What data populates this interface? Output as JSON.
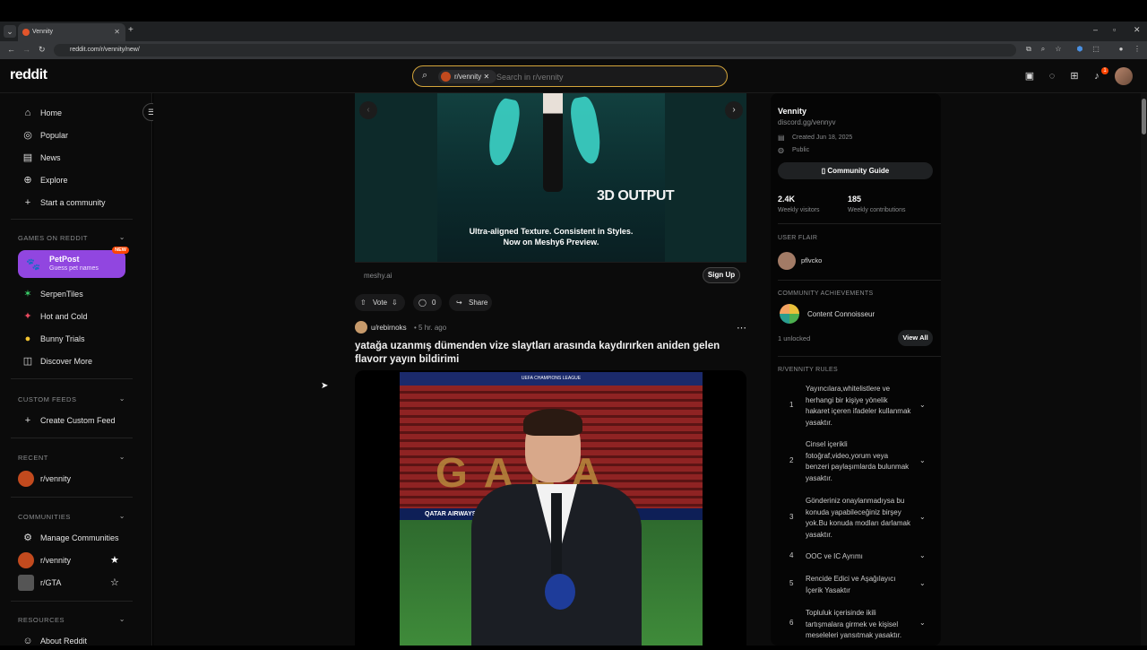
{
  "browser": {
    "tab_title": "Vennity",
    "url": "reddit.com/r/vennity/new/",
    "new_tab_symbol": "+"
  },
  "header": {
    "logo": "reddit",
    "search_chip": "r/vennity",
    "search_placeholder": "Search in r/vennity",
    "notification_count": "1"
  },
  "sidebar": {
    "nav": [
      {
        "label": "Home",
        "icon": "home-icon"
      },
      {
        "label": "Popular",
        "icon": "popular-icon"
      },
      {
        "label": "News",
        "icon": "news-icon"
      },
      {
        "label": "Explore",
        "icon": "explore-icon"
      },
      {
        "label": "Start a community",
        "icon": "plus-icon"
      }
    ],
    "games_heading": "GAMES ON REDDIT",
    "petpost": {
      "title": "PetPost",
      "subtitle": "Guess pet names",
      "badge": "NEW"
    },
    "games": [
      "SerpenTiles",
      "Hot and Cold",
      "Bunny Trials",
      "Discover More"
    ],
    "custom_feeds_heading": "CUSTOM FEEDS",
    "create_custom_feed": "Create Custom Feed",
    "recent_heading": "RECENT",
    "recent": [
      "r/vennity"
    ],
    "communities_heading": "COMMUNITIES",
    "manage_communities": "Manage Communities",
    "communities": [
      "r/vennity",
      "r/GTA"
    ],
    "resources_heading": "RESOURCES",
    "about": "About Reddit"
  },
  "ad": {
    "overlay_title": "3D OUTPUT",
    "caption_line1": "Ultra-aligned Texture. Consistent in Styles.",
    "caption_line2": "Now on Meshy6 Preview.",
    "domain": "meshy.ai",
    "cta": "Sign Up"
  },
  "actions": {
    "vote": "Vote",
    "comments": "0",
    "share": "Share"
  },
  "post": {
    "user": "u/rebirnoks",
    "time": "• 5 hr. ago",
    "title": "yatağa uzanmış dümenden vize slaytları arasında kaydırırken aniden gelen flavorr yayın bildirimi",
    "banner_text": "UEFA CHAMPIONS LEAGUE",
    "board_text": "QATAR AIRWAYS",
    "stadium_letters": "GALA"
  },
  "community": {
    "name": "Vennity",
    "link": "discord.gg/vennyv",
    "created": "Created Jun 18, 2025",
    "visibility": "Public",
    "guide_button": "Community Guide",
    "visitors_value": "2.4K",
    "visitors_label": "Weekly visitors",
    "contrib_value": "185",
    "contrib_label": "Weekly contributions",
    "flair_heading": "USER FLAIR",
    "flair_user": "pflvcko",
    "achievements_heading": "COMMUNITY ACHIEVEMENTS",
    "achievement": "Content Connoisseur",
    "unlocked": "1 unlocked",
    "view_all": "View All",
    "rules_heading": "R/VENNITY RULES",
    "rules": [
      {
        "num": "1",
        "text": "Yayıncılara,whitelistlere ve herhangi bir kişiye yönelik hakaret içeren ifadeler kullanmak yasaktır."
      },
      {
        "num": "2",
        "text": "Cinsel içerikli fotoğraf,video,yorum veya benzeri paylaşımlarda bulunmak yasaktır."
      },
      {
        "num": "3",
        "text": "Gönderiniz onaylanmadıysa bu konuda yapabileceğiniz birşey yok.Bu konuda modları darlamak yasaktır."
      },
      {
        "num": "4",
        "text": "OOC ve IC Ayrımı"
      },
      {
        "num": "5",
        "text": "Rencide Edici ve Aşağılayıcı İçerik Yasaktır"
      },
      {
        "num": "6",
        "text": "Topluluk içerisinde ikili tartışmalara girmek ve kişisel meseleleri yansıtmak yasaktır."
      }
    ]
  },
  "colors": {
    "accent": "#ff4500",
    "petpost": "#9146e0",
    "search_border": "#d4a53b"
  }
}
